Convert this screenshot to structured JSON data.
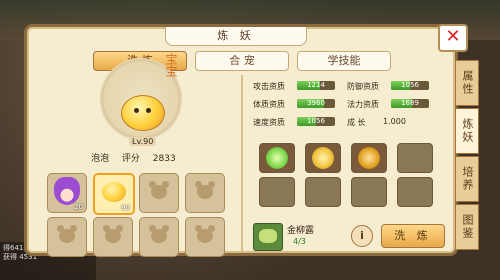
{
  "window": {
    "title": "炼 妖"
  },
  "tabs": [
    {
      "label": "洗 炼",
      "active": true
    },
    {
      "label": "合 宠",
      "active": false
    },
    {
      "label": "学技能",
      "active": false
    }
  ],
  "side_tabs": [
    {
      "label": "属性",
      "active": false
    },
    {
      "label": "炼妖",
      "active": true
    },
    {
      "label": "培养",
      "active": false
    },
    {
      "label": "图鉴",
      "active": false
    }
  ],
  "pet": {
    "display_name": "宝宝",
    "level_label": "Lv.90",
    "name": "泡泡",
    "score_label": "评分",
    "score": "2833"
  },
  "stats": [
    {
      "label": "攻击资质",
      "value": "1214",
      "fill": 0.6
    },
    {
      "label": "防御资质",
      "value": "1056",
      "fill": 0.5
    },
    {
      "label": "体质资质",
      "value": "3960",
      "fill": 0.7
    },
    {
      "label": "法力资质",
      "value": "1689",
      "fill": 0.55
    },
    {
      "label": "速度资质",
      "value": "1056",
      "fill": 0.5
    }
  ],
  "growth": {
    "label": "成   长",
    "value": "1.000"
  },
  "pet_slots": [
    {
      "type": "girl",
      "level": "20"
    },
    {
      "type": "blob",
      "level": "90",
      "selected": true
    },
    {
      "type": "empty"
    },
    {
      "type": "empty"
    },
    {
      "type": "empty"
    },
    {
      "type": "empty"
    },
    {
      "type": "empty"
    },
    {
      "type": "empty"
    }
  ],
  "skills": [
    {
      "icon": "leaf-skill-icon",
      "color": "#7cd64a"
    },
    {
      "icon": "gold-charm-skill-icon",
      "color": "#f0c23a"
    },
    {
      "icon": "golden-idol-skill-icon",
      "color": "#e0a020"
    },
    {
      "icon": "empty"
    },
    {
      "icon": "empty"
    },
    {
      "icon": "empty"
    },
    {
      "icon": "empty"
    },
    {
      "icon": "empty"
    }
  ],
  "item": {
    "name": "金柳露",
    "count": "4/3"
  },
  "info_label": "i",
  "wash_button": "洗 炼",
  "chat_lines": [
    "得641520经验奖励",
    "获得 4531"
  ]
}
